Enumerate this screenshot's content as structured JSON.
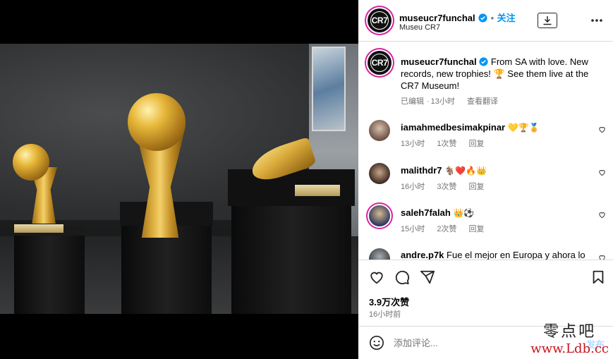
{
  "post": {
    "username": "museucr7funchal",
    "follow_label": "关注",
    "location": "Museu CR7",
    "caption_user": "museucr7funchal",
    "caption_text": "From SA with love. New records, new trophies! 🏆 See them live at the CR7 Museum!",
    "caption_edited": "已编辑",
    "caption_time": "13小时",
    "caption_translate": "查看翻译",
    "likes": "3.9万次赞",
    "posted": "16小时前"
  },
  "comments": [
    {
      "user": "iamahmedbesimakpinar",
      "text": "💛🏆🏅",
      "time": "13小时",
      "likes": "1次赞",
      "reply": "回复"
    },
    {
      "user": "malithdr7",
      "text": "🐐❤️🔥👑",
      "time": "16小时",
      "likes": "3次赞",
      "reply": "回复"
    },
    {
      "user": "saleh7falah",
      "text": "👑⚽",
      "time": "15小时",
      "likes": "2次赞",
      "reply": "回复"
    },
    {
      "user": "andre.p7k",
      "text": "Fue el mejor en Europa y ahora lo",
      "time": "",
      "likes": "",
      "reply": ""
    }
  ],
  "add_comment": {
    "placeholder": "添加评论...",
    "post_label": "发布"
  },
  "watermark": {
    "cn": "零点吧",
    "url": "www.Ldb.cc"
  },
  "icons": {
    "download": "download-icon",
    "more": "more-horizontal-icon",
    "like": "heart-icon",
    "comment": "comment-bubble-icon",
    "share": "paper-plane-icon",
    "save": "bookmark-icon",
    "emoji": "smiley-icon"
  },
  "colors": {
    "link_blue": "#0095f6",
    "muted": "#737373",
    "border": "#dbdbdb",
    "watermark_red": "#c8141e"
  }
}
